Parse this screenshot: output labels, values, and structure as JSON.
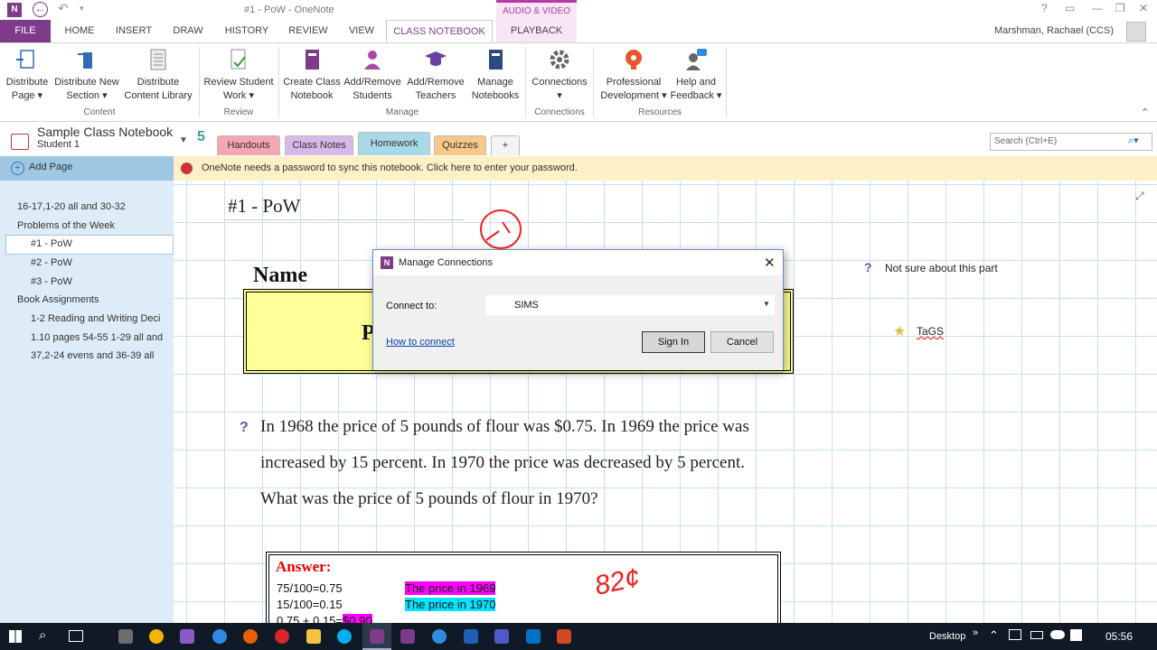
{
  "titlebar": {
    "title": "#1 - PoW - OneNote",
    "context_group": "AUDIO & VIDEO"
  },
  "ribbon_tabs": [
    "FILE",
    "HOME",
    "INSERT",
    "DRAW",
    "HISTORY",
    "REVIEW",
    "VIEW",
    "CLASS NOTEBOOK",
    "PLAYBACK"
  ],
  "user": "Marshman, Rachael (CCS)",
  "ribbon": {
    "buttons": {
      "distribute_page": [
        "Distribute",
        "Page"
      ],
      "distribute_new_section": [
        "Distribute New",
        "Section"
      ],
      "distribute_content_library": [
        "Distribute",
        "Content Library"
      ],
      "review_student_work": [
        "Review Student",
        "Work"
      ],
      "create_class_notebook": [
        "Create Class",
        "Notebook"
      ],
      "add_remove_students": [
        "Add/Remove",
        "Students"
      ],
      "add_remove_teachers": [
        "Add/Remove",
        "Teachers"
      ],
      "manage_notebooks": [
        "Manage",
        "Notebooks"
      ],
      "connections": [
        "Connections"
      ],
      "professional_development": [
        "Professional",
        "Development"
      ],
      "help_and_feedback": [
        "Help and",
        "Feedback"
      ]
    },
    "groups": {
      "content": "Content",
      "review": "Review",
      "manage": "Manage",
      "connections": "Connections",
      "resources": "Resources"
    }
  },
  "notebook": {
    "name": "Sample Class Notebook",
    "section": "Student 1"
  },
  "section_tabs": [
    "Handouts",
    "Class Notes",
    "Homework",
    "Quizzes",
    "+"
  ],
  "search": {
    "placeholder": "Search (Ctrl+E)"
  },
  "left_pane": {
    "add_page": "Add Page",
    "pages": [
      "16-17,1-20 all and 30-32",
      "Problems of the Week",
      "#1 - PoW",
      "#2 - PoW",
      "#3 - PoW",
      "Book Assignments",
      "1-2 Reading and Writing Deci",
      "1.10 pages 54-55 1-29 all and",
      "37,2-24 evens and 36-39 all"
    ]
  },
  "notification": "OneNote needs a password to sync this notebook. Click here to enter your password.",
  "page": {
    "title": "#1 - PoW",
    "name_label": "Name",
    "box_letter": "P",
    "side_question": "Not sure about this part",
    "side_tag": "TaGS",
    "problem_lines": [
      "In 1968 the price of 5 pounds of flour was $0.75. In 1969 the price was",
      "increased by 15 percent. In 1970 the price was decreased by 5 percent.",
      "What was the price of 5 pounds of flour in 1970?"
    ],
    "answer_label": "Answer:",
    "answer_lines": [
      "75/100=0.75",
      "15/100=0.15",
      "0.75 + 0.15="
    ],
    "answer_highlight": "$0.90",
    "legend_1969": "The price in 1969",
    "legend_1970": "The price in 1970",
    "handwriting": "82¢"
  },
  "dialog": {
    "title": "Manage Connections",
    "connect_label": "Connect to:",
    "connect_value": "SIMS",
    "how_link": "How to connect",
    "sign_in": "Sign In",
    "cancel": "Cancel"
  },
  "taskbar": {
    "desktop_label": "Desktop",
    "time": "05:56"
  },
  "colors": {
    "onenote_purple": "#7e3b8a",
    "highlight_magenta": "#ff00ff",
    "highlight_cyan": "#00e5ff",
    "name_box_fill": "#ffff99"
  }
}
